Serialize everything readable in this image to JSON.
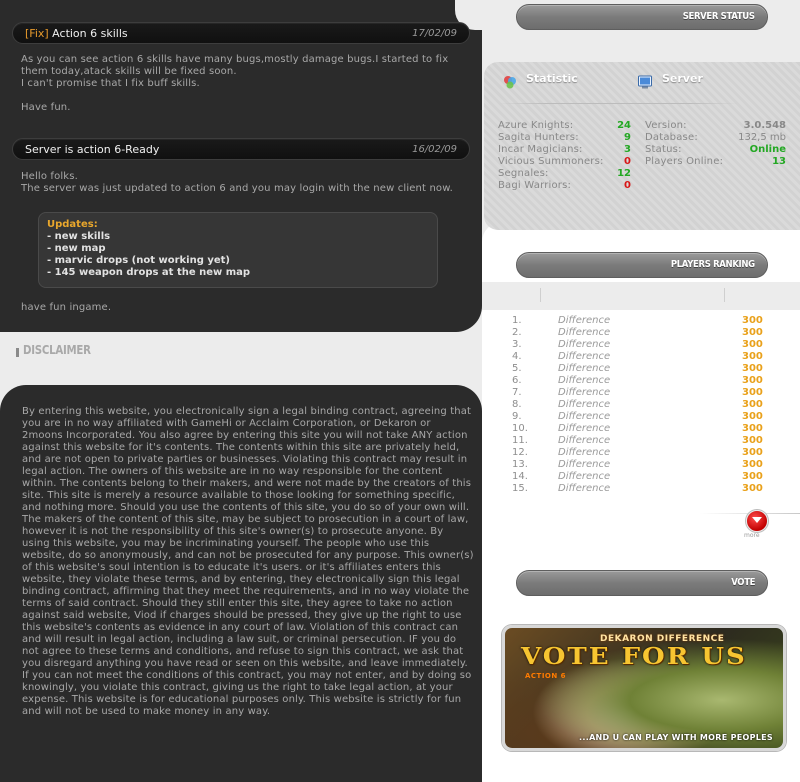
{
  "news": [
    {
      "tag": "[Fix]",
      "title": " Action 6 skills",
      "date": "17/02/09",
      "body": [
        "As you can see action 6 skills have many bugs,mostly damage bugs.I started to fix them today,atack skills will be fixed soon.",
        "I can't promise that I fix buff skills.",
        "",
        "Have fun."
      ]
    },
    {
      "tag": "",
      "title": "Server is action 6-Ready",
      "date": "16/02/09",
      "body": [
        "Hello folks.",
        "The server was just updated to action 6 and you may login with the new client now."
      ],
      "updates": {
        "title": "Updates:",
        "items": [
          "- new skills",
          "- new map",
          "- marvic drops (not working yet)",
          "- 145 weapon drops at the new map"
        ]
      },
      "footer": "have fun ingame."
    }
  ],
  "disclaimer": {
    "title": "DISCLAIMER",
    "text": "By entering this website, you electronically sign a legal binding contract, agreeing that you are in no way affiliated with GameHi or Acclaim Corporation, or Dekaron or 2moons Incorporated. You also agree by entering this site you will not take ANY action against this website for it's contents. The contents within this site are privately held, and are not open to private parties or businesses. Violating this contract may result in legal action. The owners of this website are in no way responsible for the content within. The contents belong to their makers, and were not made by the creators of this site. This site is merely a resource available to those looking for something specific, and nothing more. Should you use the contents of this site, you do so of your own will. The makers of the content of this site, may be subject to prosecution in a court of law, however it is not the responsibility of this site's owner(s) to prosecute anyone. By using this website, you may be incriminating yourself. The people who use this website, do so anonymously, and can not be prosecuted for any purpose. This owner(s) of this website's soul intention is to educate it's users.  or it's affiliates enters this website, they violate these terms, and by entering, they electronically sign this legal binding contract, affirming that they meet the requirements, and in no way violate the terms of said contract. Should they still enter this site, they agree to take no action against said website, Viod if charges should be pressed, they give up the right to use this website's contents as evidence in any court of law. Violation of this contract can and will result in legal action, including a law suit, or criminal persecution. IF you do not agree to these terms and conditions, and refuse to sign this contract, we ask that you disregard anything you have read or seen on this website, and leave immediately. If you can not meet the conditions of this contract, you may not enter, and by doing so knowingly, you violate this contract, giving us the right to take legal action, at your expense. This website is for educational purposes only. This website is strictly for fun and will not be used to make money in any way."
  },
  "server_status": {
    "header": "SERVER STATUS",
    "statistic_label": "Statistic",
    "server_label": "Server",
    "statistics": [
      {
        "label": "Azure Knights:",
        "value": "24",
        "color": "#24a824"
      },
      {
        "label": "Sagita Hunters:",
        "value": "9",
        "color": "#24a824"
      },
      {
        "label": "Incar Magicians:",
        "value": "3",
        "color": "#24a824"
      },
      {
        "label": "Vicious Summoners:",
        "value": "0",
        "color": "#d81616"
      },
      {
        "label": "Segnales:",
        "value": "12",
        "color": "#24a824"
      },
      {
        "label": "Bagi Warriors:",
        "value": "0",
        "color": "#d81616"
      }
    ],
    "server": [
      {
        "label": "Version:",
        "value": "3.0.548",
        "color": "#888888"
      },
      {
        "label": "Database:",
        "value": "132,5 mb",
        "color": "#888888"
      },
      {
        "label": "Status:",
        "value": "Online",
        "color": "#24a824"
      },
      {
        "label": "Players Online:",
        "value": "13",
        "color": "#24a824"
      }
    ]
  },
  "players_ranking": {
    "header": "PLAYERS RANKING",
    "rows": [
      {
        "rank": "1.",
        "name": "Difference",
        "points": "300"
      },
      {
        "rank": "2.",
        "name": "Difference",
        "points": "300"
      },
      {
        "rank": "3.",
        "name": "Difference",
        "points": "300"
      },
      {
        "rank": "4.",
        "name": "Difference",
        "points": "300"
      },
      {
        "rank": "5.",
        "name": "Difference",
        "points": "300"
      },
      {
        "rank": "6.",
        "name": "Difference",
        "points": "300"
      },
      {
        "rank": "7.",
        "name": "Difference",
        "points": "300"
      },
      {
        "rank": "8.",
        "name": "Difference",
        "points": "300"
      },
      {
        "rank": "9.",
        "name": "Difference",
        "points": "300"
      },
      {
        "rank": "10.",
        "name": "Difference",
        "points": "300"
      },
      {
        "rank": "11.",
        "name": "Difference",
        "points": "300"
      },
      {
        "rank": "12.",
        "name": "Difference",
        "points": "300"
      },
      {
        "rank": "13.",
        "name": "Difference",
        "points": "300"
      },
      {
        "rank": "14.",
        "name": "Difference",
        "points": "300"
      },
      {
        "rank": "15.",
        "name": "Difference",
        "points": "300"
      }
    ],
    "more_label": "more"
  },
  "vote": {
    "header": "VOTE",
    "banner_subtitle": "DEKARON DIFFERENCE",
    "banner_title": "VOTE FOR US",
    "banner_small": "ACTION 6",
    "banner_tagline": "...AND U CAN PLAY WITH MORE PEOPLES"
  }
}
